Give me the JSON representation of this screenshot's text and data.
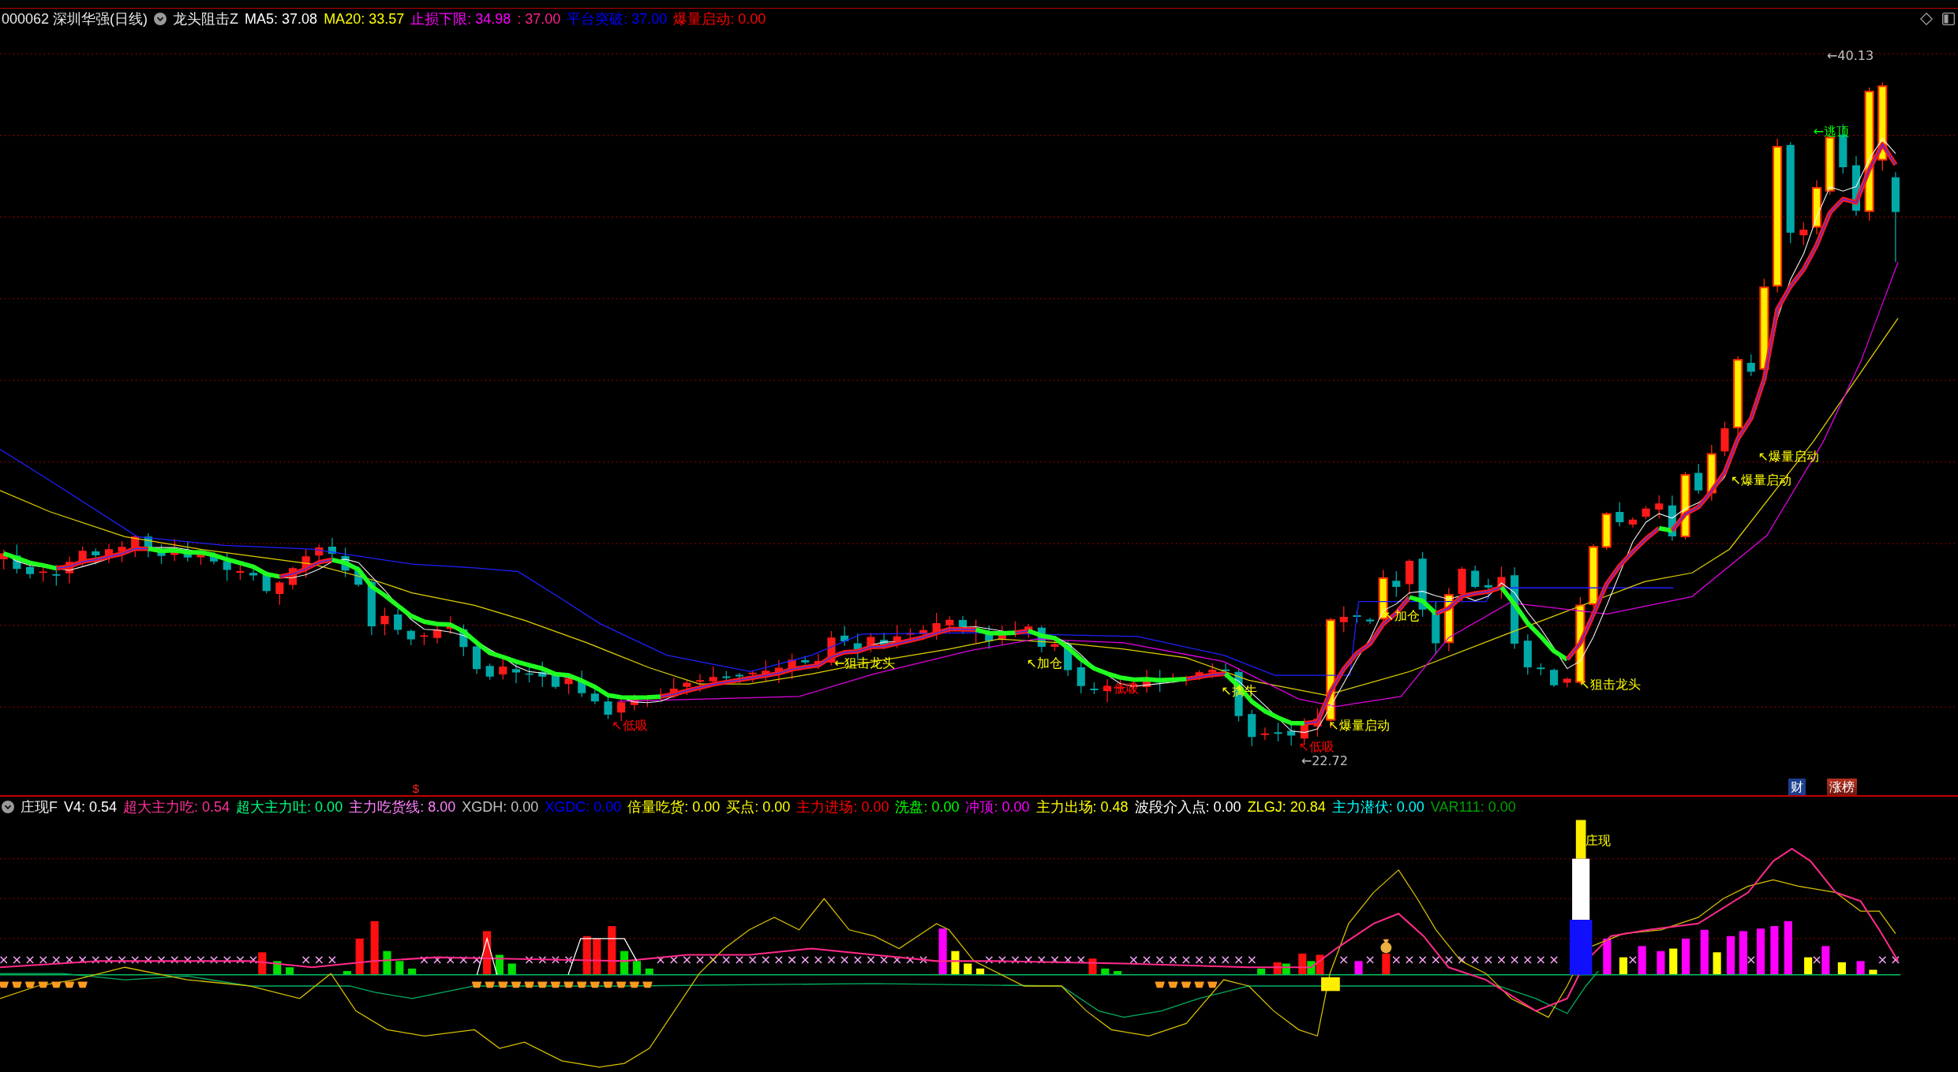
{
  "main_header": {
    "symbol": "000062 深圳华强(日线)",
    "indicator": "龙头阻击Z",
    "values": [
      {
        "text": "MA5: 37.08",
        "color": "#ffffff"
      },
      {
        "text": "MA20: 33.57",
        "color": "#ffff00"
      },
      {
        "text": "止损下限: 34.98",
        "color": "#ff00ff"
      },
      {
        "text": ": 37.00",
        "color": "#ff2090"
      },
      {
        "text": "平台突破: 37.00",
        "color": "#0000ff"
      },
      {
        "text": "爆量启动: 0.00",
        "color": "#ff0000"
      }
    ]
  },
  "main_chart": {
    "labels": [
      {
        "text": "←40.13",
        "color": "#c0c0c0"
      },
      {
        "text": "←逃顶",
        "color": "#00ff00"
      },
      {
        "text": "↖爆量启动",
        "color": "#ffff00"
      },
      {
        "text": "↖爆量启动",
        "color": "#ffff00"
      },
      {
        "text": "↖加仓",
        "color": "#ffff00"
      },
      {
        "text": "↖加仓",
        "color": "#ffff00"
      },
      {
        "text": "←狙击龙头",
        "color": "#ffff00"
      },
      {
        "text": "↖狙击龙头",
        "color": "#ffff00"
      },
      {
        "text": "↖擒牛",
        "color": "#ffff00"
      },
      {
        "text": "↖低吸",
        "color": "#ff0000"
      },
      {
        "text": "↖低吸",
        "color": "#ff0000"
      },
      {
        "text": "↖爆量启动",
        "color": "#ffff00"
      },
      {
        "text": "↖低吸",
        "color": "#ff0000"
      },
      {
        "text": "←22.72",
        "color": "#c0c0c0"
      }
    ],
    "marker": "$",
    "buttons": [
      {
        "text": "财",
        "kind": "finance"
      },
      {
        "text": "涨榜",
        "kind": "rank"
      }
    ]
  },
  "indicator_header": {
    "name": "庄现F",
    "values": [
      {
        "text": "V4: 0.54",
        "color": "#ffffff"
      },
      {
        "text": "超大主力吃: 0.54",
        "color": "#ff3399"
      },
      {
        "text": "超大主力吐: 0.00",
        "color": "#00ff7f"
      },
      {
        "text": "主力吃货线: 8.00",
        "color": "#ff80ff"
      },
      {
        "text": "XGDH: 0.00",
        "color": "#c0c0c0"
      },
      {
        "text": "XGDC: 0.00",
        "color": "#0000ff"
      },
      {
        "text": "倍量吃货: 0.00",
        "color": "#ffff00"
      },
      {
        "text": "买点: 0.00",
        "color": "#ffff00"
      },
      {
        "text": "主力进场: 0.00",
        "color": "#ff0000"
      },
      {
        "text": "洗盘: 0.00",
        "color": "#00ff00"
      },
      {
        "text": "冲顶: 0.00",
        "color": "#ff00ff"
      },
      {
        "text": "主力出场: 0.48",
        "color": "#ffff00"
      },
      {
        "text": "波段介入点: 0.00",
        "color": "#ffffff"
      },
      {
        "text": "ZLGJ: 20.84",
        "color": "#ffff00"
      },
      {
        "text": "主力潜伏: 0.00",
        "color": "#00ffff"
      },
      {
        "text": "VAR111: 0.00",
        "color": "#00a000"
      }
    ]
  },
  "indicator_chart": {
    "label": "庄现"
  }
}
